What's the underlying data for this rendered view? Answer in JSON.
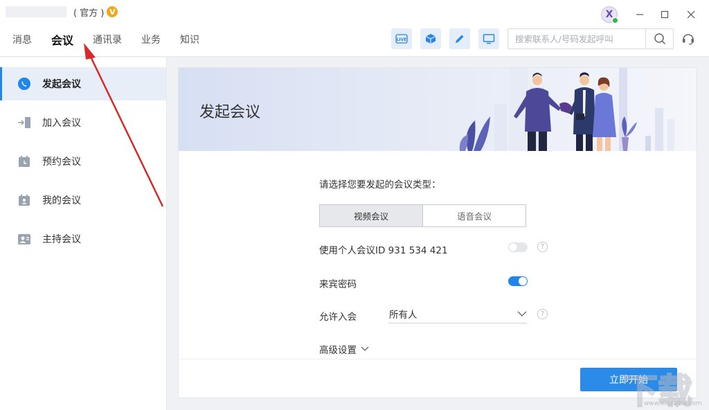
{
  "titlebar": {
    "app_suffix": "( 官方 )",
    "vip_badge": "V",
    "avatar_letter": "X",
    "min_label": "—",
    "max_label": "☐",
    "close_label": "✕"
  },
  "nav": {
    "items": [
      {
        "label": "消息",
        "active": false
      },
      {
        "label": "会议",
        "active": true
      },
      {
        "label": "通讯录",
        "active": false
      },
      {
        "label": "业务",
        "active": false
      },
      {
        "label": "知识",
        "active": false
      }
    ]
  },
  "toolbar": {
    "icons": [
      "live-icon",
      "cube-icon",
      "pencil-icon",
      "screen-icon"
    ],
    "live_text": "LIVE"
  },
  "search": {
    "placeholder": "搜索联系人/号码发起呼叫"
  },
  "sidebar": {
    "items": [
      {
        "label": "发起会议",
        "icon": "start-meeting-icon",
        "active": true
      },
      {
        "label": "加入会议",
        "icon": "join-meeting-icon",
        "active": false
      },
      {
        "label": "预约会议",
        "icon": "schedule-meeting-icon",
        "active": false
      },
      {
        "label": "我的会议",
        "icon": "my-meeting-icon",
        "active": false
      },
      {
        "label": "主持会议",
        "icon": "host-meeting-icon",
        "active": false
      }
    ]
  },
  "main": {
    "banner_title": "发起会议",
    "prompt": "请选择您要发起的会议类型：",
    "types": {
      "video": "视频会议",
      "voice": "语音会议",
      "selected": "video"
    },
    "personal_id": {
      "label": "使用个人会议ID 931 534 421",
      "enabled": false
    },
    "guest_password": {
      "label": "来宾密码",
      "enabled": true
    },
    "allow_join": {
      "label": "允许入会",
      "value": "所有人"
    },
    "advanced_label": "高级设置",
    "start_button": "立即开始",
    "help_mark": "?"
  },
  "colors": {
    "accent": "#1f86ec",
    "button": "#2b8be9",
    "vip": "#f0a81a",
    "annotation_arrow": "#d42a2a"
  },
  "watermark": {
    "text": "下载",
    "url": "www.xiazaiba.com"
  }
}
